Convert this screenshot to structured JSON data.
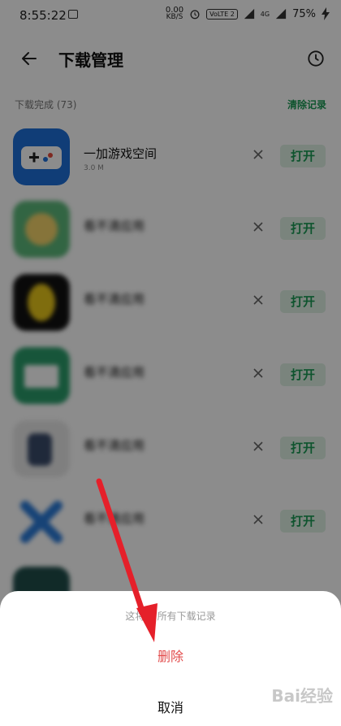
{
  "status_bar": {
    "time": "8:55:22",
    "net_speed_value": "0.00",
    "net_speed_unit": "KB/S",
    "volte": "VoLTE 2",
    "network": "4G",
    "battery": "75%"
  },
  "header": {
    "title": "下载管理"
  },
  "section": {
    "label": "下载完成 (73)",
    "clear_label": "清除记录"
  },
  "apps": [
    {
      "name": "一加游戏空间",
      "size": "3.0 M",
      "open_label": "打开",
      "icon_color": "#1e6fd9"
    },
    {
      "name": "看不清应用",
      "size": "",
      "open_label": "打开",
      "icon_color": "#5cb87a"
    },
    {
      "name": "看不清应用",
      "size": "",
      "open_label": "打开",
      "icon_color": "#111111"
    },
    {
      "name": "看不清应用",
      "size": "",
      "open_label": "打开",
      "icon_color": "#2a9c6a"
    },
    {
      "name": "看不清应用",
      "size": "",
      "open_label": "打开",
      "icon_color": "#e8e8e8"
    },
    {
      "name": "看不清应用",
      "size": "",
      "open_label": "打开",
      "icon_color": "#ffffff"
    }
  ],
  "dialog": {
    "message": "这将··· 所有下载记录",
    "delete_label": "删除",
    "cancel_label": "取消"
  },
  "watermark": "Bai经验",
  "colors": {
    "accent_green": "#1a9a54",
    "danger_red": "#e24a4a",
    "arrow_red": "#e5202a"
  }
}
